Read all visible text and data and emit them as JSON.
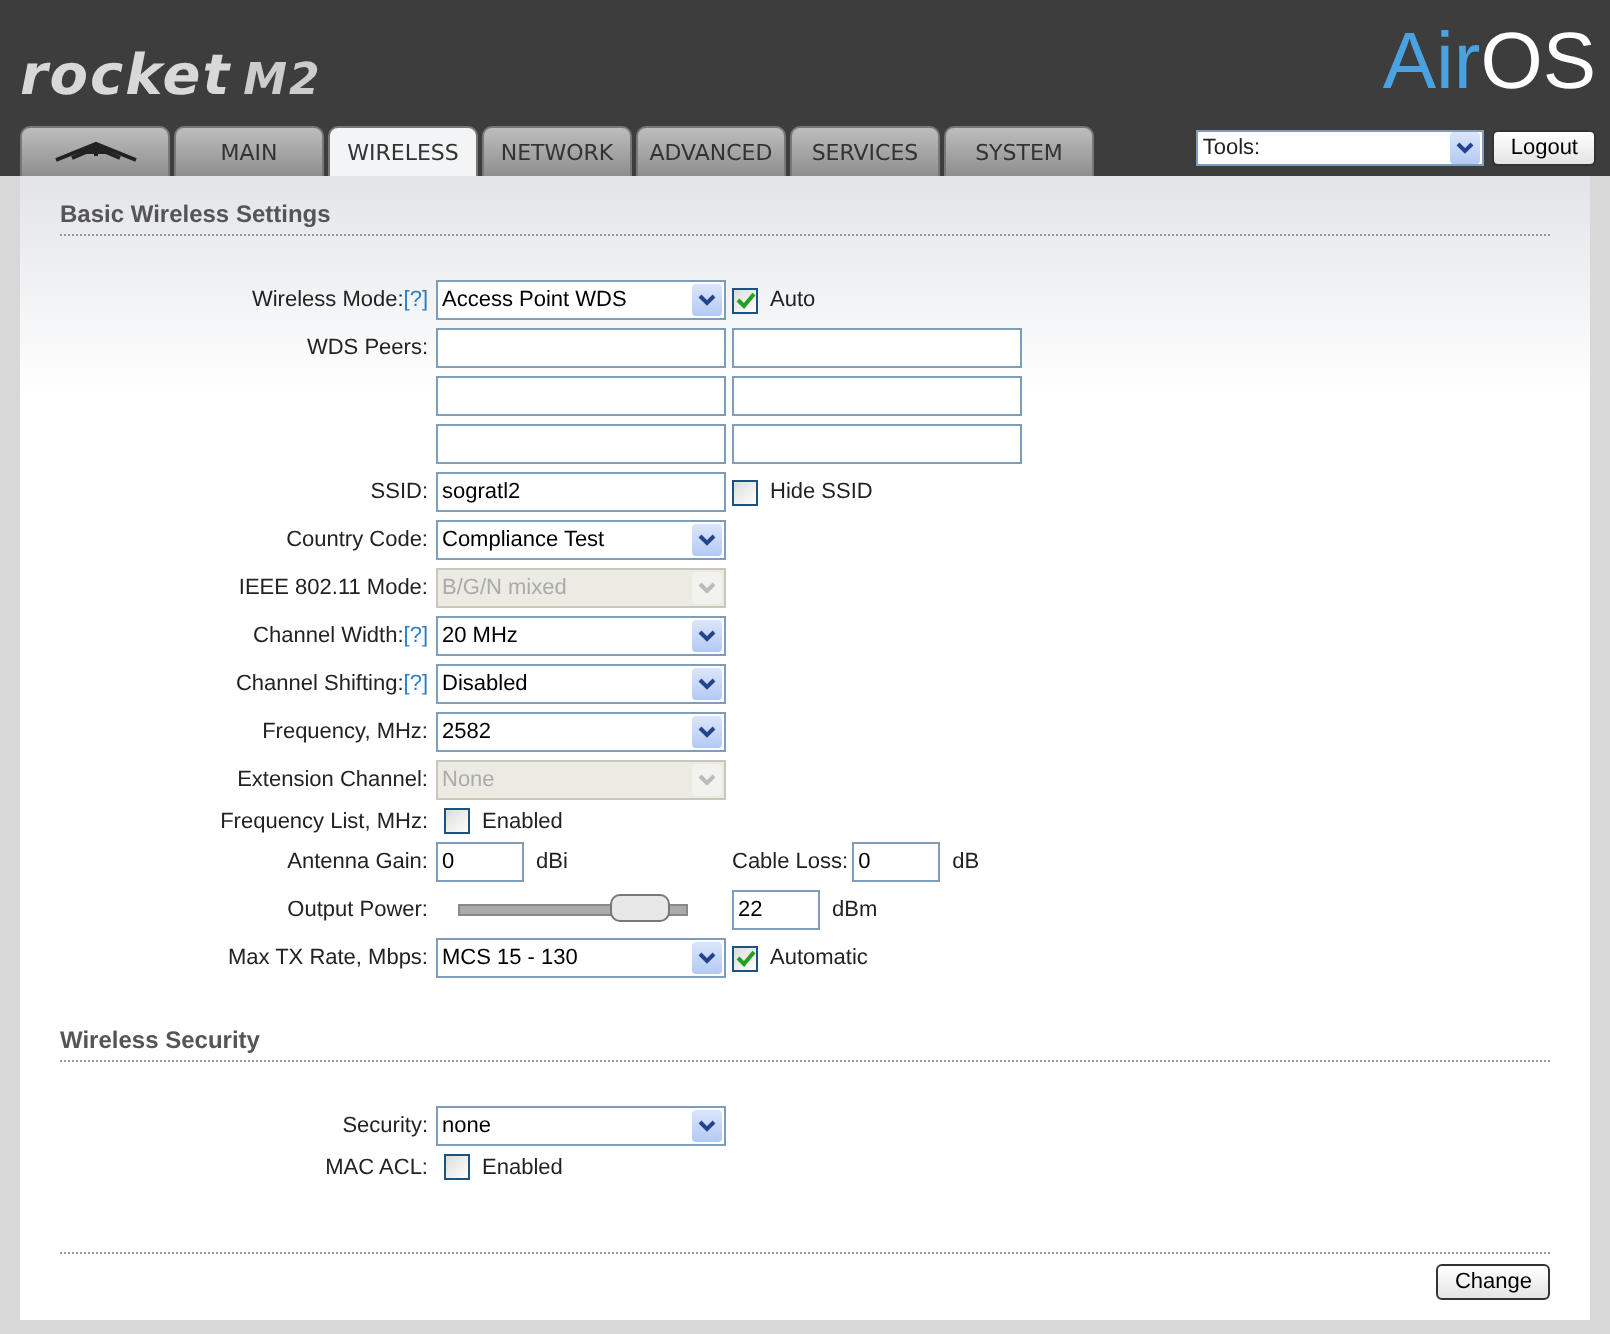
{
  "header": {
    "product": "rocket",
    "model": "M2",
    "brand_a": "Air",
    "brand_b": "OS"
  },
  "tabs": [
    {
      "kind": "logo",
      "selected": false
    },
    {
      "kind": "text",
      "label": "MAIN",
      "selected": false
    },
    {
      "kind": "text",
      "label": "WIRELESS",
      "selected": true
    },
    {
      "kind": "text",
      "label": "NETWORK",
      "selected": false
    },
    {
      "kind": "text",
      "label": "ADVANCED",
      "selected": false
    },
    {
      "kind": "text",
      "label": "SERVICES",
      "selected": false
    },
    {
      "kind": "text",
      "label": "SYSTEM",
      "selected": false
    }
  ],
  "tools": {
    "value": "Tools:",
    "logout": "Logout"
  },
  "sections": [
    {
      "title": "Basic Wireless Settings",
      "rows": [
        {
          "kind": "select",
          "label": "Wireless Mode:",
          "help": "[?]",
          "value": "Access Point WDS",
          "disabled": false,
          "check": {
            "label": "Auto",
            "checked": true
          }
        },
        {
          "kind": "peers",
          "label": "WDS Peers:"
        },
        {
          "kind": "text",
          "label": "SSID:",
          "value": "sogratl2",
          "check": {
            "label": "Hide SSID",
            "checked": false
          }
        },
        {
          "kind": "select",
          "label": "Country Code:",
          "value": "Compliance Test",
          "disabled": false
        },
        {
          "kind": "select",
          "label": "IEEE 802.11 Mode:",
          "value": "B/G/N mixed",
          "disabled": true
        },
        {
          "kind": "select",
          "label": "Channel Width:",
          "help": "[?]",
          "value": "20 MHz",
          "disabled": false
        },
        {
          "kind": "select",
          "label": "Channel Shifting:",
          "help": "[?]",
          "value": "Disabled",
          "disabled": false
        },
        {
          "kind": "select",
          "label": "Frequency, MHz:",
          "value": "2582",
          "disabled": false
        },
        {
          "kind": "select",
          "label": "Extension Channel:",
          "value": "None",
          "disabled": true
        },
        {
          "kind": "checkbox",
          "label": "Frequency List, MHz:",
          "check": {
            "label": "Enabled",
            "checked": false
          }
        },
        {
          "kind": "gain",
          "label": "Antenna Gain:",
          "value": "0",
          "unit": "dBi",
          "label2": "Cable Loss:",
          "value2": "0",
          "unit2": "dB"
        },
        {
          "kind": "slider",
          "label": "Output Power:",
          "level": 0.8,
          "value": "22",
          "unit": "dBm"
        },
        {
          "kind": "select",
          "label": "Max TX Rate, Mbps:",
          "value": "MCS 15 - 130",
          "disabled": false,
          "check": {
            "label": "Automatic",
            "checked": true
          }
        }
      ]
    },
    {
      "title": "Wireless Security",
      "rows": [
        {
          "kind": "select",
          "label": "Security:",
          "value": "none",
          "disabled": false
        },
        {
          "kind": "checkbox",
          "label": "MAC ACL:",
          "check": {
            "label": "Enabled",
            "checked": false
          }
        }
      ]
    }
  ],
  "submit": "Change"
}
